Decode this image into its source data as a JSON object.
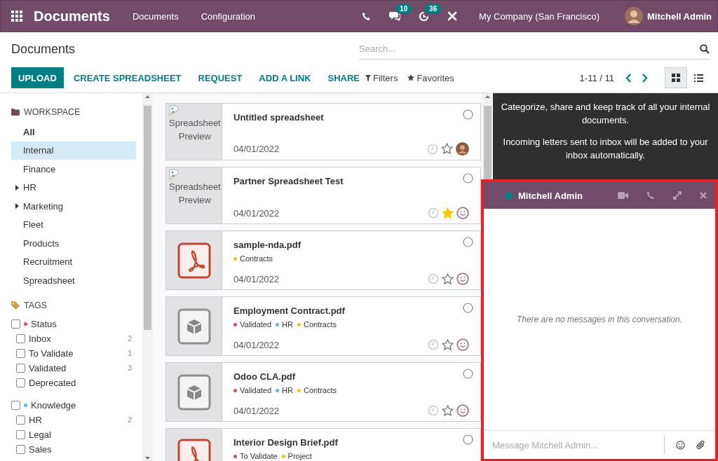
{
  "navbar": {
    "app_title": "Documents",
    "menu": [
      "Documents",
      "Configuration"
    ],
    "messages_badge": "10",
    "activities_badge": "36",
    "company": "My Company (San Francisco)",
    "user": "Mitchell Admin"
  },
  "control_panel": {
    "breadcrumb": "Documents",
    "search": {
      "placeholder": "Search..."
    },
    "buttons": [
      {
        "label": "UPLOAD",
        "kind": "primary"
      },
      {
        "label": "CREATE SPREADSHEET",
        "kind": "link"
      },
      {
        "label": "REQUEST",
        "kind": "link"
      },
      {
        "label": "ADD A LINK",
        "kind": "link"
      },
      {
        "label": "SHARE",
        "kind": "link"
      }
    ],
    "filters": "Filters",
    "favorites": "Favorites",
    "pager": "1-11 / 11",
    "views": [
      {
        "kind": "kanban",
        "selected": true
      },
      {
        "kind": "list",
        "selected": false
      }
    ]
  },
  "sidebar": {
    "workspace_heading": "WORKSPACE",
    "workspaces": [
      {
        "label": "All",
        "kind": "root",
        "expandable": false,
        "selected": false
      },
      {
        "label": "Internal",
        "kind": "folder",
        "expandable": false,
        "selected": true
      },
      {
        "label": "Finance",
        "kind": "folder",
        "expandable": false,
        "selected": false
      },
      {
        "label": "HR",
        "kind": "folder",
        "expandable": true,
        "selected": false
      },
      {
        "label": "Marketing",
        "kind": "folder",
        "expandable": true,
        "selected": false
      },
      {
        "label": "Fleet",
        "kind": "folder",
        "expandable": false,
        "selected": false
      },
      {
        "label": "Products",
        "kind": "folder",
        "expandable": false,
        "selected": false
      },
      {
        "label": "Recruitment",
        "kind": "folder",
        "expandable": false,
        "selected": false
      },
      {
        "label": "Spreadsheet",
        "kind": "folder",
        "expandable": false,
        "selected": false
      }
    ],
    "tags_heading": "TAGS",
    "tag_groups": [
      {
        "label": "Status",
        "color": "#dc4d4d",
        "checked": false,
        "tags": [
          {
            "label": "Inbox",
            "count": "2",
            "checked": false
          },
          {
            "label": "To Validate",
            "count": "1",
            "checked": false
          },
          {
            "label": "Validated",
            "count": "3",
            "checked": false
          },
          {
            "label": "Deprecated",
            "checked": false
          }
        ]
      },
      {
        "label": "Knowledge",
        "color": "#5fb6e8",
        "checked": false,
        "tags": [
          {
            "label": "HR",
            "count": "2",
            "checked": false
          },
          {
            "label": "Legal",
            "checked": false
          },
          {
            "label": "Sales",
            "checked": false
          }
        ]
      }
    ]
  },
  "documents": [
    {
      "title": "Untitled spreadsheet",
      "preview": {
        "kind": "spreadsheet",
        "alt_text": "Spreadsheet Preview"
      },
      "date": "04/01/2022",
      "selected": false,
      "favorite": false,
      "owner": {
        "kind": "photo"
      }
    },
    {
      "title": "Partner Spreadsheet Test",
      "preview": {
        "kind": "spreadsheet",
        "alt_text": "Spreadsheet Preview"
      },
      "date": "04/01/2022",
      "selected": false,
      "favorite": true,
      "owner": {
        "kind": "smiley"
      }
    },
    {
      "title": "sample-nda.pdf",
      "preview": {
        "kind": "pdf"
      },
      "tags": [
        {
          "label": "Contracts",
          "color": "#f2c31a"
        }
      ],
      "date": "04/01/2022",
      "selected": false,
      "favorite": false,
      "owner": {
        "kind": "smiley"
      }
    },
    {
      "title": "Employment Contract.pdf",
      "preview": {
        "kind": "binary"
      },
      "tags": [
        {
          "label": "Validated",
          "color": "#dc4d4d"
        },
        {
          "label": "HR",
          "color": "#5fb6e8"
        },
        {
          "label": "Contracts",
          "color": "#f2c31a"
        }
      ],
      "date": "04/01/2022",
      "selected": false,
      "favorite": false,
      "owner": {
        "kind": "smiley"
      }
    },
    {
      "title": "Odoo CLA.pdf",
      "preview": {
        "kind": "binary"
      },
      "tags": [
        {
          "label": "Validated",
          "color": "#dc4d4d"
        },
        {
          "label": "HR",
          "color": "#5fb6e8"
        },
        {
          "label": "Contracts",
          "color": "#f2c31a"
        }
      ],
      "date": "04/01/2022",
      "selected": false,
      "favorite": false,
      "owner": {
        "kind": "smiley"
      }
    },
    {
      "title": "Interior Design Brief.pdf",
      "preview": {
        "kind": "pdf"
      },
      "tags": [
        {
          "label": "To Validate",
          "color": "#dc4d4d"
        },
        {
          "label": "Project",
          "color": "#f2c31a"
        }
      ],
      "selected": false
    }
  ],
  "help": [
    "Categorize, share and keep track of all your internal documents.",
    "Incoming letters sent to inbox will be added to your inbox automatically."
  ],
  "chat": {
    "name": "Mitchell Admin",
    "online": true,
    "highlighted": true,
    "empty_text": "There are no messages in this conversation.",
    "composer": {
      "placeholder": "Message Mitchell Admin..."
    }
  }
}
